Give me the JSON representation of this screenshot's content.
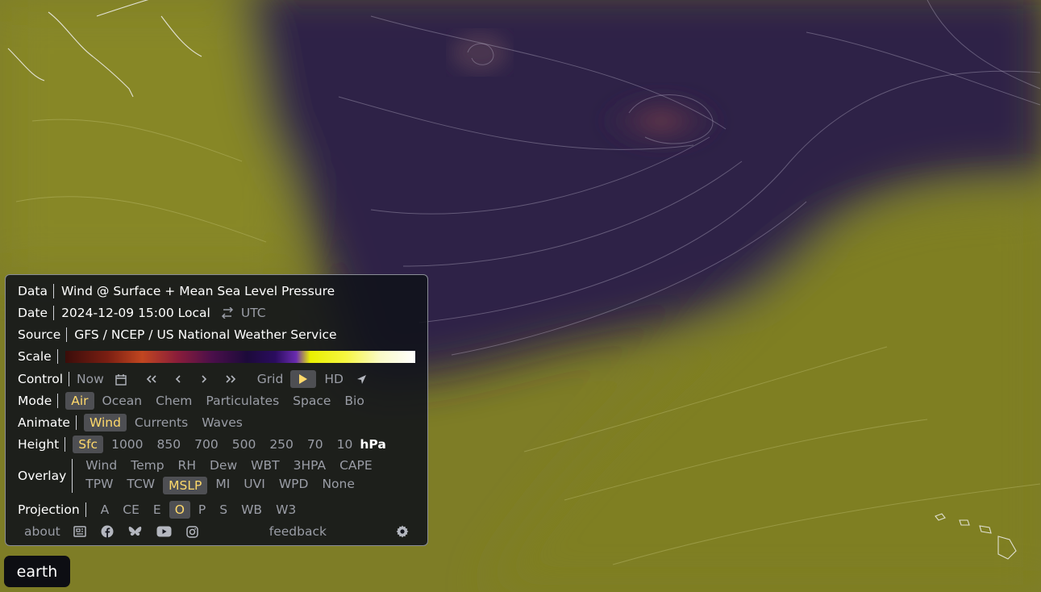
{
  "panel": {
    "data": {
      "label": "Data",
      "value": "Wind @ Surface + Mean Sea Level Pressure"
    },
    "date": {
      "label": "Date",
      "value": "2024-12-09 15:00 Local",
      "swap_icon": "swap-arrows-icon",
      "alt": "UTC"
    },
    "source": {
      "label": "Source",
      "value": "GFS / NCEP / US National Weather Service"
    },
    "scale": {
      "label": "Scale",
      "colors": [
        "#3a0d0a",
        "#c14620",
        "#4a0f4a",
        "#2a0c5e",
        "#eaf000",
        "#ffffff"
      ]
    },
    "control": {
      "label": "Control",
      "now": "Now",
      "grid": "Grid",
      "hd": "HD",
      "icons": [
        "calendar-icon",
        "double-left-icon",
        "left-icon",
        "right-icon",
        "double-right-icon",
        "play-icon",
        "location-arrow-icon"
      ]
    },
    "mode": {
      "label": "Mode",
      "options": [
        "Air",
        "Ocean",
        "Chem",
        "Particulates",
        "Space",
        "Bio"
      ],
      "selected": "Air"
    },
    "animate": {
      "label": "Animate",
      "options": [
        "Wind",
        "Currents",
        "Waves"
      ],
      "selected": "Wind"
    },
    "height": {
      "label": "Height",
      "options": [
        "Sfc",
        "1000",
        "850",
        "700",
        "500",
        "250",
        "70",
        "10"
      ],
      "unit": "hPa",
      "selected": "Sfc"
    },
    "overlay": {
      "label": "Overlay",
      "row1": [
        "Wind",
        "Temp",
        "RH",
        "Dew",
        "WBT",
        "3HPA",
        "CAPE"
      ],
      "row2": [
        "TPW",
        "TCW",
        "MSLP",
        "MI",
        "UVI",
        "WPD",
        "None"
      ],
      "selected": "MSLP"
    },
    "projection": {
      "label": "Projection",
      "options": [
        "A",
        "CE",
        "E",
        "O",
        "P",
        "S",
        "WB",
        "W3"
      ],
      "selected": "O"
    },
    "footer": {
      "about": "about",
      "feedback": "feedback",
      "icons": [
        "newspaper-icon",
        "facebook-icon",
        "bluesky-icon",
        "youtube-icon",
        "instagram-icon",
        "gear-icon"
      ]
    }
  },
  "earth_button": "earth",
  "colors": {
    "olive": "#8a8a22",
    "purple": "#2e1f4a",
    "accent": "#ffd96b"
  }
}
